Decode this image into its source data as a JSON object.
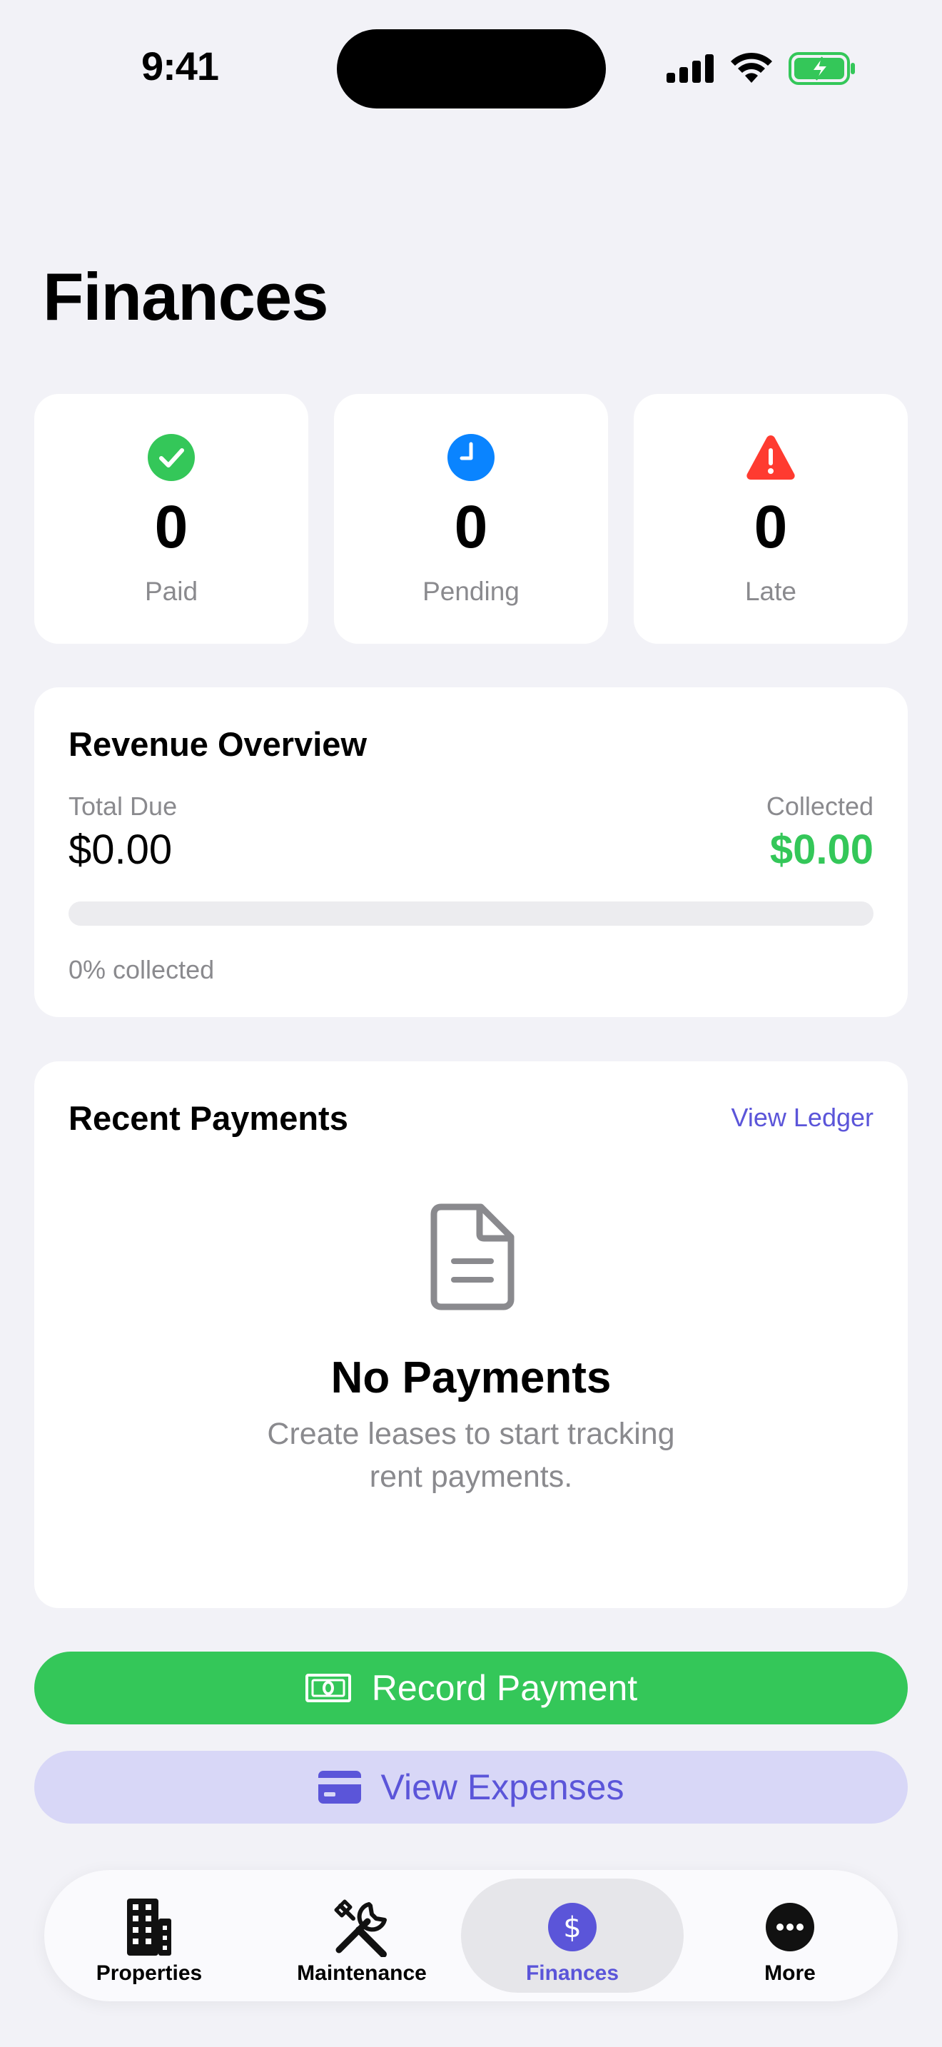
{
  "status_bar": {
    "time": "9:41"
  },
  "page": {
    "title": "Finances"
  },
  "stats": [
    {
      "value": "0",
      "label": "Paid",
      "icon": "checkmark-circle-icon",
      "color": "#34c759"
    },
    {
      "value": "0",
      "label": "Pending",
      "icon": "clock-icon",
      "color": "#0a84ff"
    },
    {
      "value": "0",
      "label": "Late",
      "icon": "warning-triangle-icon",
      "color": "#ff3b30"
    }
  ],
  "revenue": {
    "title": "Revenue Overview",
    "total_due_label": "Total Due",
    "total_due_value": "$0.00",
    "collected_label": "Collected",
    "collected_value": "$0.00",
    "progress_fraction": 0,
    "progress_text": "0% collected"
  },
  "payments": {
    "title": "Recent Payments",
    "link": "View Ledger",
    "empty_title": "No Payments",
    "empty_subtitle": "Create leases to start tracking rent payments."
  },
  "actions": {
    "record_payment": "Record Payment",
    "view_expenses": "View Expenses"
  },
  "tabs": [
    {
      "label": "Properties",
      "icon": "building-icon"
    },
    {
      "label": "Maintenance",
      "icon": "tools-icon"
    },
    {
      "label": "Finances",
      "icon": "dollar-circle-icon",
      "active": true
    },
    {
      "label": "More",
      "icon": "ellipsis-circle-icon"
    }
  ],
  "colors": {
    "accent": "#5b55d9",
    "success": "#34c759",
    "background": "#f2f2f7"
  }
}
